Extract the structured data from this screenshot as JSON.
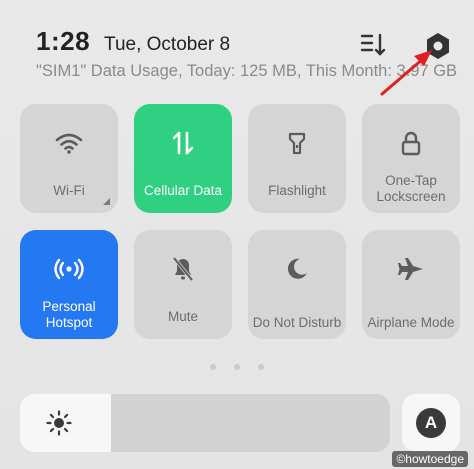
{
  "status_bar": {
    "time": "1:28",
    "date": "Tue, October 8",
    "data_usage": "\"SIM1\" Data Usage, Today: 125 MB, This Month: 3.97 GB"
  },
  "top_icons": [
    "sort-icon",
    "settings-icon"
  ],
  "tiles": [
    {
      "label": "Wi-Fi",
      "icon": "wifi-icon",
      "active": false
    },
    {
      "label": "Cellular Data",
      "icon": "cellular-data-icon",
      "active": true,
      "color": "#2fd081"
    },
    {
      "label": "Flashlight",
      "icon": "flashlight-icon",
      "active": false
    },
    {
      "label": "One-Tap Lockscreen",
      "icon": "lock-icon",
      "active": false
    },
    {
      "label": "Personal Hotspot",
      "icon": "hotspot-icon",
      "active": true,
      "color": "#2479f2"
    },
    {
      "label": "Mute",
      "icon": "mute-icon",
      "active": false
    },
    {
      "label": "Do Not Disturb",
      "icon": "moon-icon",
      "active": false
    },
    {
      "label": "Airplane Mode",
      "icon": "airplane-icon",
      "active": false
    }
  ],
  "brightness": {
    "level": 0.245,
    "icon": "sun-icon"
  },
  "auto_brightness": {
    "label": "A"
  },
  "watermark": "©howtoedge",
  "colors": {
    "accent_green": "#2fd081",
    "accent_blue": "#2479f2",
    "annotation_red": "#e02020"
  }
}
